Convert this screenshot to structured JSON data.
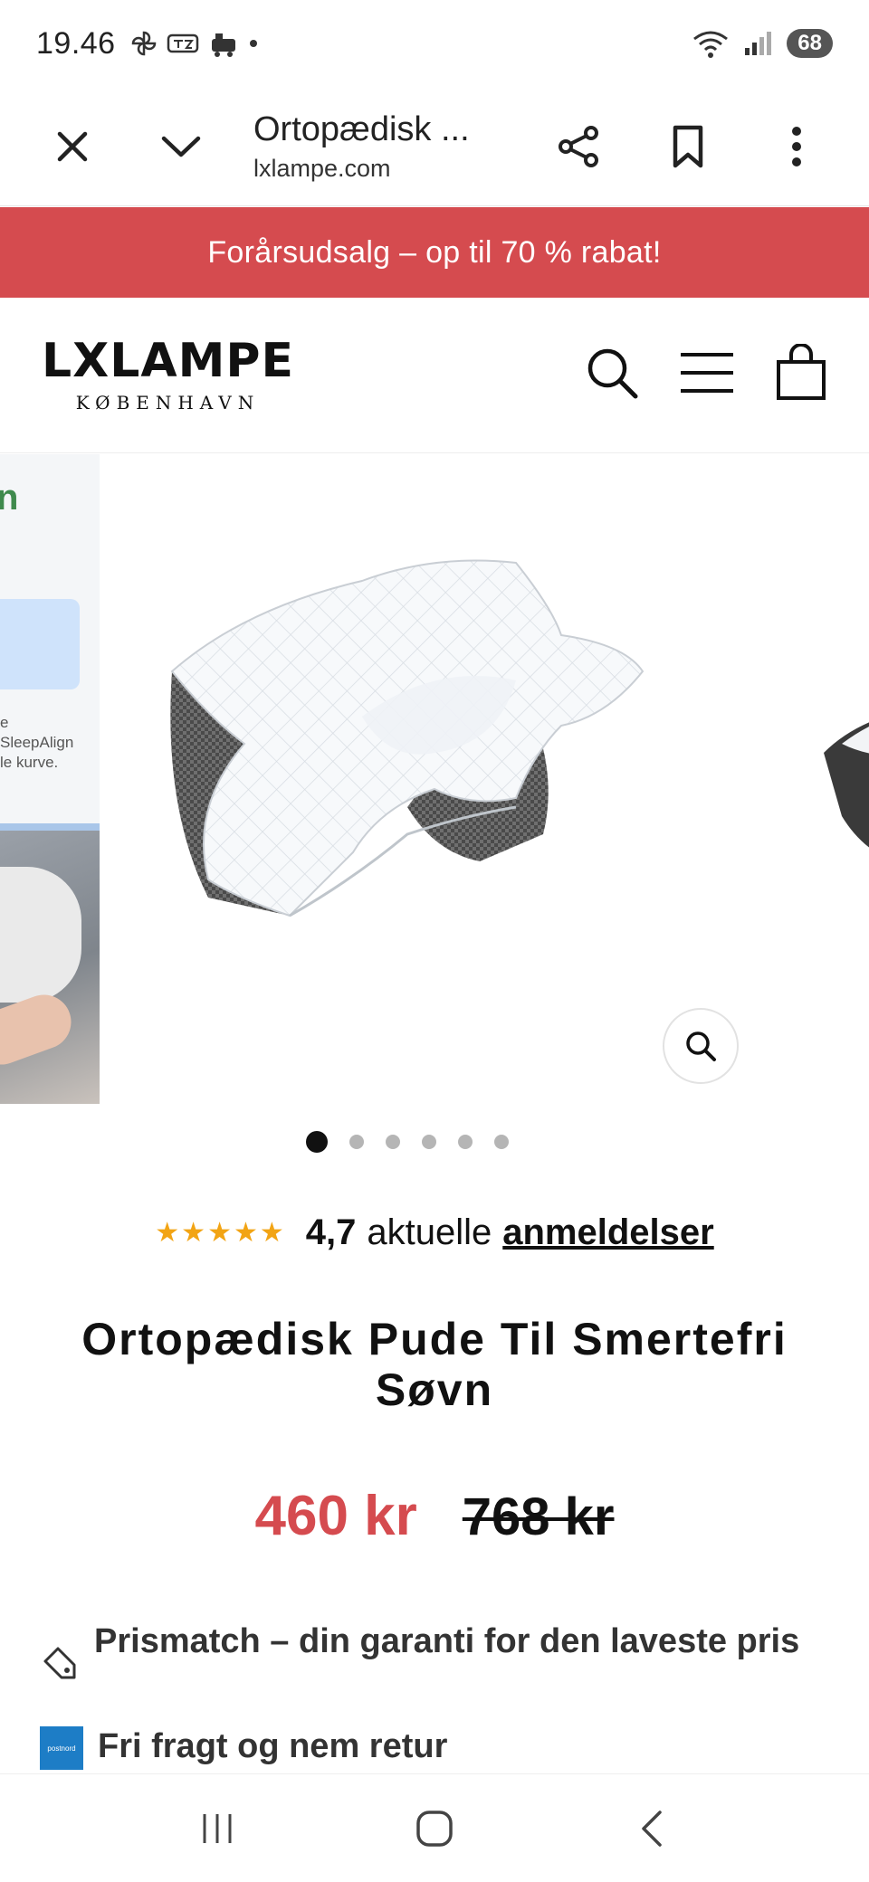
{
  "status_bar": {
    "time": "19.46",
    "battery": "68"
  },
  "browser": {
    "page_title": "Ortopædisk ...",
    "url": "lxlampe.com"
  },
  "promo_banner": {
    "text": "Forårsudsalg – op til 70 % rabat!",
    "color": "#d54b4f"
  },
  "store": {
    "logo_main": "LXLAMPE",
    "logo_sub": "KØBENHAVN"
  },
  "gallery": {
    "thumb_left_text": [
      "e",
      "SleepAlign",
      "le kurve."
    ],
    "dots_count": 6,
    "active_dot": 0
  },
  "rating": {
    "stars": "★★★★★",
    "score": "4,7",
    "text": "aktuelle",
    "link": "anmeldelser"
  },
  "product": {
    "title": "Ortopædisk Pude Til Smertefri Søvn",
    "price": "460 kr",
    "old_price": "768 kr",
    "price_color": "#d54b4f"
  },
  "features": [
    {
      "icon": "tag-icon",
      "text": "Prismatch – din garanti for den laveste pris"
    },
    {
      "icon": "postnord-icon",
      "text": "Fri fragt og nem retur",
      "badge": "postnord"
    }
  ]
}
